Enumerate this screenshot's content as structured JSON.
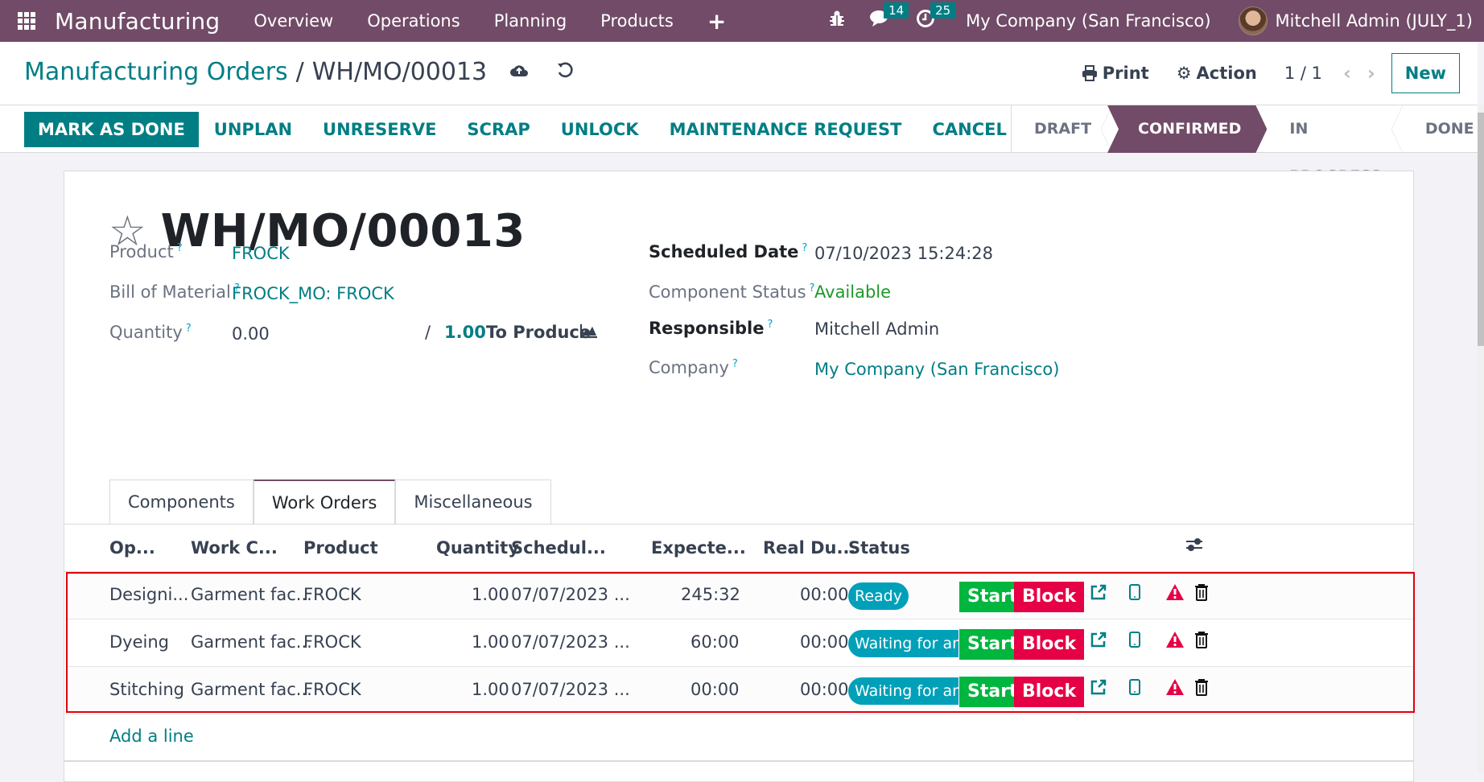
{
  "navbar": {
    "app_name": "Manufacturing",
    "menus": [
      "Overview",
      "Operations",
      "Planning",
      "Products"
    ],
    "plus_label": "+",
    "messages_count": "14",
    "activities_count": "25",
    "company": "My Company (San Francisco)",
    "user": "Mitchell Admin (JULY_1)"
  },
  "breadcrumb": {
    "parent": "Manufacturing Orders",
    "separator": "/",
    "current": "WH/MO/00013"
  },
  "control": {
    "print_label": "Print",
    "action_label": "Action",
    "pager": "1 / 1",
    "new_label": "New"
  },
  "buttons": {
    "mark_done": "MARK AS DONE",
    "unplan": "UNPLAN",
    "unreserve": "UNRESERVE",
    "scrap": "SCRAP",
    "unlock": "UNLOCK",
    "maintenance": "MAINTENANCE REQUEST",
    "cancel": "CANCEL"
  },
  "statusbar": {
    "stages": [
      "DRAFT",
      "CONFIRMED",
      "IN PROGRESS",
      "DONE"
    ],
    "active": "CONFIRMED"
  },
  "record": {
    "title": "WH/MO/00013",
    "fields_left": {
      "product_label": "Product",
      "product_value": "FROCK",
      "bom_label": "Bill of Material",
      "bom_value": "FROCK_MO: FROCK",
      "quantity_label": "Quantity",
      "quantity_value": "0.00",
      "quantity_sep": "/",
      "quantity_target": "1.00",
      "quantity_suffix": "To Produce"
    },
    "fields_right": {
      "scheduled_label": "Scheduled Date",
      "scheduled_value": "07/10/2023 15:24:28",
      "component_label": "Component Status",
      "component_value": "Available",
      "responsible_label": "Responsible",
      "responsible_value": "Mitchell Admin",
      "company_label": "Company",
      "company_value": "My Company (San Francisco)"
    },
    "help_mark": "?"
  },
  "tabs": [
    "Components",
    "Work Orders",
    "Miscellaneous"
  ],
  "active_tab": "Work Orders",
  "work_orders": {
    "columns": [
      "Op...",
      "Work C...",
      "Product",
      "Quantity",
      "Schedul...",
      "Expecte...",
      "Real Du...",
      "Status"
    ],
    "rows": [
      {
        "operation": "Designi...",
        "work_center": "Garment fac...",
        "product": "FROCK",
        "quantity": "1.00",
        "scheduled": "07/07/2023 ...",
        "expected": "245:32",
        "real": "00:00",
        "status": "Ready",
        "start": "Start",
        "block": "Block"
      },
      {
        "operation": "Dyeing",
        "work_center": "Garment fac...",
        "product": "FROCK",
        "quantity": "1.00",
        "scheduled": "07/07/2023 ...",
        "expected": "60:00",
        "real": "00:00",
        "status": "Waiting for ano",
        "start": "Start",
        "block": "Block"
      },
      {
        "operation": "Stitching",
        "work_center": "Garment fac...",
        "product": "FROCK",
        "quantity": "1.00",
        "scheduled": "07/07/2023 ...",
        "expected": "00:00",
        "real": "00:00",
        "status": "Waiting for ano",
        "start": "Start",
        "block": "Block"
      }
    ],
    "add_line": "Add a line"
  },
  "colors": {
    "brand": "#714B67",
    "accent": "#017e84",
    "start": "#00b63e",
    "block": "#e60045",
    "status_pill": "#00a0b9",
    "available": "#1c9a2a",
    "highlight_box": "#e0000e"
  }
}
